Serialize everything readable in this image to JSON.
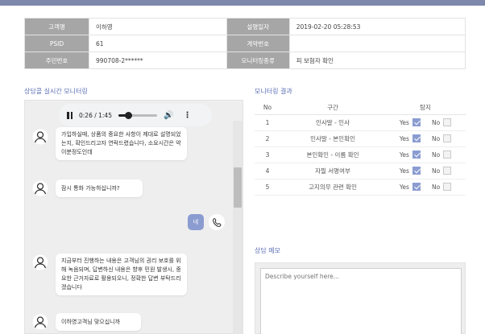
{
  "info": {
    "customer_label": "고객명",
    "customer_value": "이하영",
    "psid_label": "PSID",
    "psid_value": "61",
    "rrn_label": "주민번호",
    "rrn_value": "990708-2******",
    "reg_label": "설명일자",
    "reg_value": "2019-02-20 05:28:53",
    "contract_label": "계약번호",
    "contract_value": "",
    "monitor_type_label": "모니터링종류",
    "monitor_type_value": "피 보험자 확인"
  },
  "chat_section_title": "상담콜 실시간 모니터링",
  "player": {
    "time": "0:26 / 1:45",
    "progress": 0.25
  },
  "messages": [
    {
      "text": "가입하실때, 상품의 중요한 사항이 제대로 설명되었는지, 확인드리고자 연락드렸습니다, 소요시간은 약 이분정도인데"
    },
    {
      "text": "잠시 통화 가능하십니까?"
    },
    {
      "text": "지금부터 진행하는 내용은 고객님의 권리 보호를 위해 녹음되며, 답변하신 내용은 향후 민원 발생시, 중요한 근거자료로 활용되오니, 정확한 답변 부탁드리겠습니다"
    },
    {
      "text": "이하영고객님 맞으십니까"
    }
  ],
  "my_reply": "네",
  "result_section_title": "모니터링 결과",
  "result_headers": {
    "no": "No",
    "section": "구간",
    "check": "탐지"
  },
  "yes_label": "Yes",
  "no_label": "No",
  "results": [
    {
      "no": "1",
      "section": "인사말 - 인사",
      "yes": true,
      "no_checked": false
    },
    {
      "no": "2",
      "section": "인사말 - 본인확인",
      "yes": true,
      "no_checked": false
    },
    {
      "no": "3",
      "section": "본인확인 - 이름 확인",
      "yes": true,
      "no_checked": false
    },
    {
      "no": "4",
      "section": "자필 서명여부",
      "yes": true,
      "no_checked": false
    },
    {
      "no": "5",
      "section": "고지의무 관련 확인",
      "yes": true,
      "no_checked": false
    }
  ],
  "memo_section_title": "상담 메모",
  "memo_placeholder": "Describe yourself here...",
  "colors": {
    "accent": "#8b9cd1",
    "title": "#5b6fb5",
    "header_bar": "#7e88ab"
  }
}
